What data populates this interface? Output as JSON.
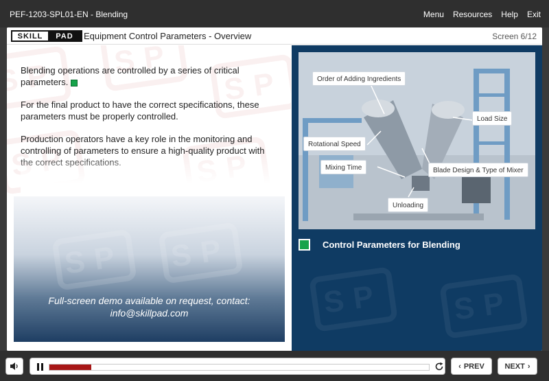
{
  "window": {
    "course_title": "PEF-1203-SPL01-EN - Blending",
    "nav": [
      "Menu",
      "Resources",
      "Help",
      "Exit"
    ]
  },
  "header": {
    "logo_text_left": "SKILL",
    "logo_text_right": "PAD",
    "screen_title": "Equipment Control Parameters - Overview",
    "screen_counter": "Screen 6/12"
  },
  "content": {
    "paragraphs": [
      "Blending operations are controlled by a series of critical parameters.",
      "For the final product to have the correct specifications, these parameters must be properly controlled.",
      "Production operators have a key role in the monitoring and controlling of parameters to ensure a high-quality product with the correct specifications."
    ],
    "promo_line1": "Full-screen demo available on request, contact:",
    "promo_line2": "info@skillpad.com",
    "watermark_text": "SP"
  },
  "diagram": {
    "callouts": [
      "Order of Adding Ingredients",
      "Load Size",
      "Rotational Speed",
      "Mixing Time",
      "Blade Design & Type of Mixer",
      "Unloading"
    ],
    "section_label": "Control Parameters for Blending"
  },
  "player": {
    "progress": 0.11,
    "prev_label": "PREV",
    "next_label": "NEXT"
  },
  "colors": {
    "accent_green": "#16a34a",
    "panel_blue": "#0f3b63",
    "progress_red": "#a71616"
  }
}
